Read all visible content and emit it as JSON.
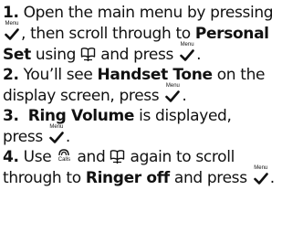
{
  "steps": [
    {
      "number": "1.",
      "t1": " Open the main menu by pressing",
      "t2": ", then scroll through to ",
      "k1": "Personal",
      "k2": "Set",
      "t3": " using ",
      "t4": " and press ",
      "t5": "."
    },
    {
      "number": "2.",
      "t1": " You’ll see ",
      "k1": "Handset Tone",
      "t2": " on the",
      "t3": "display screen, press ",
      "t4": "."
    },
    {
      "number": "3.",
      "t1": "  ",
      "k1": "Ring Volume",
      "t2": " is displayed,",
      "t3": "press ",
      "t4": "."
    },
    {
      "number": "4.",
      "t1": " Use ",
      "t2": " and ",
      "t3": " again to scroll",
      "t4": "through to ",
      "k1": "Ringer off",
      "t5": " and press ",
      "t6": "."
    }
  ],
  "icons": {
    "menu_label": "Menu",
    "calls_label": "Calls",
    "menu_icon": "menu-ok-check-icon",
    "calls_icon": "calls-scroll-icon",
    "book_icon": "phonebook-scroll-icon"
  }
}
